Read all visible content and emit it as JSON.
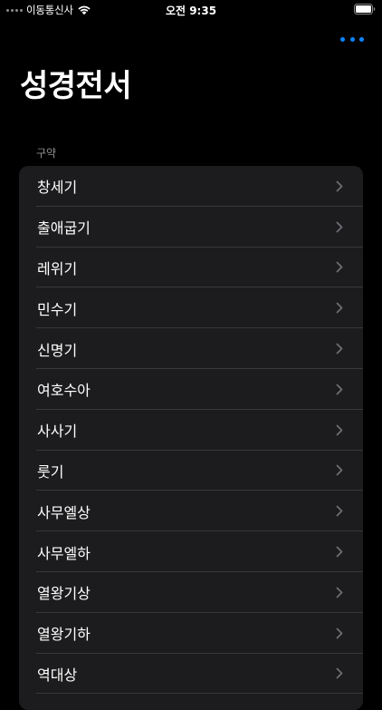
{
  "status_bar": {
    "carrier": "이동통신사",
    "time": "오전 9:35"
  },
  "header": {
    "title": "성경전서",
    "more_icon": "ellipsis-icon",
    "accent_color": "#0a84ff"
  },
  "section": {
    "header": "구약",
    "items": [
      {
        "label": "창세기"
      },
      {
        "label": "출애굽기"
      },
      {
        "label": "레위기"
      },
      {
        "label": "민수기"
      },
      {
        "label": "신명기"
      },
      {
        "label": "여호수아"
      },
      {
        "label": "사사기"
      },
      {
        "label": "룻기"
      },
      {
        "label": "사무엘상"
      },
      {
        "label": "사무엘하"
      },
      {
        "label": "열왕기상"
      },
      {
        "label": "열왕기하"
      },
      {
        "label": "역대상"
      }
    ]
  }
}
